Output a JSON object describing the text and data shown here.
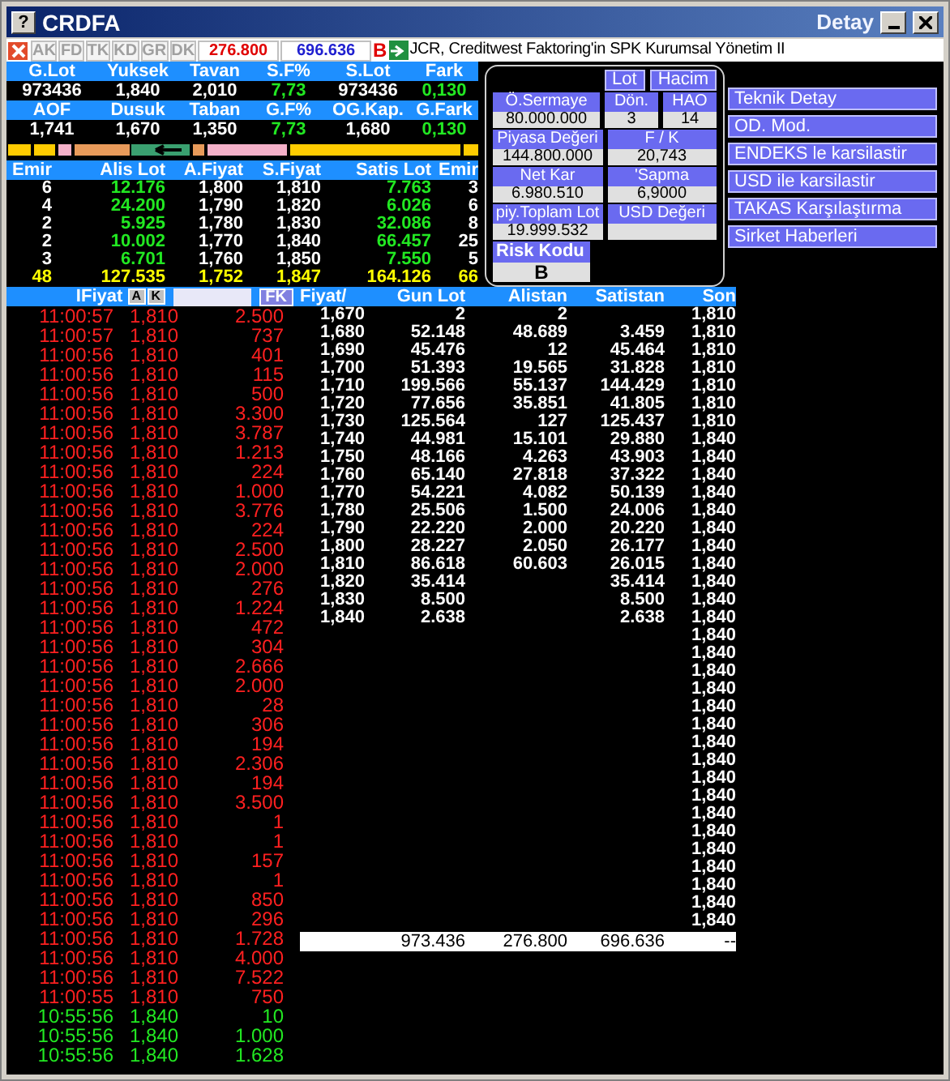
{
  "window": {
    "help": "?",
    "title": "CRDFA",
    "detail_label": "Detay"
  },
  "toolbar": {
    "tabs": [
      "AK",
      "FD",
      "TK",
      "KD",
      "GR",
      "DK"
    ],
    "sell_total": "276.800",
    "buy_total": "696.636",
    "flag": "B",
    "ticker": "JCR, Creditwest Faktoring'in SPK Kurumsal Yönetim II"
  },
  "stats": [
    [
      {
        "label": "G.Lot",
        "value": "973436",
        "kind": "plain"
      },
      {
        "label": "Yuksek",
        "value": "1,840",
        "kind": "plain"
      },
      {
        "label": "Tavan",
        "value": "2,010",
        "kind": "plain"
      },
      {
        "label": "S.F%",
        "value": "7,73",
        "kind": "up"
      },
      {
        "label": "S.Lot",
        "value": "973436",
        "kind": "plain"
      },
      {
        "label": "Fark",
        "value": "0,130",
        "kind": "up"
      }
    ],
    [
      {
        "label": "AOF",
        "value": "1,741",
        "kind": "plain"
      },
      {
        "label": "Dusuk",
        "value": "1,670",
        "kind": "plain"
      },
      {
        "label": "Taban",
        "value": "1,350",
        "kind": "plain"
      },
      {
        "label": "G.F%",
        "value": "7,73",
        "kind": "up"
      },
      {
        "label": "OG.Kap.",
        "value": "1,680",
        "kind": "plain"
      },
      {
        "label": "G.Fark",
        "value": "0,130",
        "kind": "up"
      }
    ]
  ],
  "order_book": {
    "columns": [
      "Emir",
      "Alis Lot",
      "A.Fiyat",
      "S.Fiyat",
      "Satis Lot",
      "Emir"
    ],
    "rows": [
      [
        "6",
        "12.176",
        "1,800",
        "1,810",
        "7.763",
        "3"
      ],
      [
        "4",
        "24.200",
        "1,790",
        "1,820",
        "6.026",
        "6"
      ],
      [
        "2",
        "5.925",
        "1,780",
        "1,830",
        "32.086",
        "8"
      ],
      [
        "2",
        "10.002",
        "1,770",
        "1,840",
        "66.457",
        "25"
      ],
      [
        "3",
        "6.701",
        "1,760",
        "1,850",
        "7.550",
        "5"
      ]
    ],
    "totals": [
      "48",
      "127.535",
      "1,752",
      "1,847",
      "164.126",
      "66"
    ]
  },
  "detail": {
    "buttons": [
      "Lot",
      "Hacim"
    ],
    "field_rows": [
      [
        {
          "label": "Ö.Sermaye",
          "value": "80.000.000"
        },
        {
          "label": "Dön.",
          "value": "3"
        },
        {
          "label": "HAO",
          "value": "14"
        }
      ],
      [
        {
          "label": "Piyasa Değeri",
          "value": "144.800.000"
        },
        {
          "label": "F / K",
          "value": "20,743"
        }
      ],
      [
        {
          "label": "Net Kar",
          "value": "6.980.510"
        },
        {
          "label": "'Sapma",
          "value": "6,9000"
        }
      ],
      [
        {
          "label": "piy.Toplam Lot",
          "value": "19.999.532"
        },
        {
          "label": "USD Değeri"
        }
      ]
    ],
    "risk": {
      "label": "Risk Kodu",
      "value": "B"
    }
  },
  "menu": [
    "Teknik Detay",
    "OD. Mod.",
    "ENDEKS le karsilastir",
    "USD ile karsilastir",
    "TAKAS Karşılaştırma",
    "Sirket Haberleri"
  ],
  "trades": {
    "header": "IFiyat",
    "buttons": [
      "A",
      "K"
    ],
    "fk": "FK",
    "rows": [
      {
        "time": "11:00:57",
        "price": "1,810",
        "lot": "2.500",
        "kind": "sell"
      },
      {
        "time": "11:00:57",
        "price": "1,810",
        "lot": "737",
        "kind": "sell"
      },
      {
        "time": "11:00:56",
        "price": "1,810",
        "lot": "401",
        "kind": "sell"
      },
      {
        "time": "11:00:56",
        "price": "1,810",
        "lot": "115",
        "kind": "sell"
      },
      {
        "time": "11:00:56",
        "price": "1,810",
        "lot": "500",
        "kind": "sell"
      },
      {
        "time": "11:00:56",
        "price": "1,810",
        "lot": "3.300",
        "kind": "sell"
      },
      {
        "time": "11:00:56",
        "price": "1,810",
        "lot": "3.787",
        "kind": "sell"
      },
      {
        "time": "11:00:56",
        "price": "1,810",
        "lot": "1.213",
        "kind": "sell"
      },
      {
        "time": "11:00:56",
        "price": "1,810",
        "lot": "224",
        "kind": "sell"
      },
      {
        "time": "11:00:56",
        "price": "1,810",
        "lot": "1.000",
        "kind": "sell"
      },
      {
        "time": "11:00:56",
        "price": "1,810",
        "lot": "3.776",
        "kind": "sell"
      },
      {
        "time": "11:00:56",
        "price": "1,810",
        "lot": "224",
        "kind": "sell"
      },
      {
        "time": "11:00:56",
        "price": "1,810",
        "lot": "2.500",
        "kind": "sell"
      },
      {
        "time": "11:00:56",
        "price": "1,810",
        "lot": "2.000",
        "kind": "sell"
      },
      {
        "time": "11:00:56",
        "price": "1,810",
        "lot": "276",
        "kind": "sell"
      },
      {
        "time": "11:00:56",
        "price": "1,810",
        "lot": "1.224",
        "kind": "sell"
      },
      {
        "time": "11:00:56",
        "price": "1,810",
        "lot": "472",
        "kind": "sell"
      },
      {
        "time": "11:00:56",
        "price": "1,810",
        "lot": "304",
        "kind": "sell"
      },
      {
        "time": "11:00:56",
        "price": "1,810",
        "lot": "2.666",
        "kind": "sell"
      },
      {
        "time": "11:00:56",
        "price": "1,810",
        "lot": "2.000",
        "kind": "sell"
      },
      {
        "time": "11:00:56",
        "price": "1,810",
        "lot": "28",
        "kind": "sell"
      },
      {
        "time": "11:00:56",
        "price": "1,810",
        "lot": "306",
        "kind": "sell"
      },
      {
        "time": "11:00:56",
        "price": "1,810",
        "lot": "194",
        "kind": "sell"
      },
      {
        "time": "11:00:56",
        "price": "1,810",
        "lot": "2.306",
        "kind": "sell"
      },
      {
        "time": "11:00:56",
        "price": "1,810",
        "lot": "194",
        "kind": "sell"
      },
      {
        "time": "11:00:56",
        "price": "1,810",
        "lot": "3.500",
        "kind": "sell"
      },
      {
        "time": "11:00:56",
        "price": "1,810",
        "lot": "1",
        "kind": "sell"
      },
      {
        "time": "11:00:56",
        "price": "1,810",
        "lot": "1",
        "kind": "sell"
      },
      {
        "time": "11:00:56",
        "price": "1,810",
        "lot": "157",
        "kind": "sell"
      },
      {
        "time": "11:00:56",
        "price": "1,810",
        "lot": "1",
        "kind": "sell"
      },
      {
        "time": "11:00:56",
        "price": "1,810",
        "lot": "850",
        "kind": "sell"
      },
      {
        "time": "11:00:56",
        "price": "1,810",
        "lot": "296",
        "kind": "sell"
      },
      {
        "time": "11:00:56",
        "price": "1,810",
        "lot": "1.728",
        "kind": "sell"
      },
      {
        "time": "11:00:56",
        "price": "1,810",
        "lot": "4.000",
        "kind": "sell"
      },
      {
        "time": "11:00:56",
        "price": "1,810",
        "lot": "7.522",
        "kind": "sell"
      },
      {
        "time": "11:00:55",
        "price": "1,810",
        "lot": "750",
        "kind": "sell"
      },
      {
        "time": "10:55:56",
        "price": "1,840",
        "lot": "10",
        "kind": "buy"
      },
      {
        "time": "10:55:56",
        "price": "1,840",
        "lot": "1.000",
        "kind": "buy"
      },
      {
        "time": "10:55:56",
        "price": "1,840",
        "lot": "1.628",
        "kind": "buy"
      }
    ]
  },
  "price_table": {
    "columns": [
      "Fiyat/",
      "Gun Lot",
      "Alistan",
      "Satistan",
      "Son"
    ],
    "rows": [
      {
        "fiyat": "1,670",
        "gun_lot": "2",
        "alistan": "2",
        "son": "1,810"
      },
      {
        "fiyat": "1,680",
        "gun_lot": "52.148",
        "alistan": "48.689",
        "satistan": "3.459",
        "son": "1,810"
      },
      {
        "fiyat": "1,690",
        "gun_lot": "45.476",
        "alistan": "12",
        "satistan": "45.464",
        "son": "1,810"
      },
      {
        "fiyat": "1,700",
        "gun_lot": "51.393",
        "alistan": "19.565",
        "satistan": "31.828",
        "son": "1,810"
      },
      {
        "fiyat": "1,710",
        "gun_lot": "199.566",
        "alistan": "55.137",
        "satistan": "144.429",
        "son": "1,810"
      },
      {
        "fiyat": "1,720",
        "gun_lot": "77.656",
        "alistan": "35.851",
        "satistan": "41.805",
        "son": "1,810"
      },
      {
        "fiyat": "1,730",
        "gun_lot": "125.564",
        "alistan": "127",
        "satistan": "125.437",
        "son": "1,810"
      },
      {
        "fiyat": "1,740",
        "gun_lot": "44.981",
        "alistan": "15.101",
        "satistan": "29.880",
        "son": "1,840"
      },
      {
        "fiyat": "1,750",
        "gun_lot": "48.166",
        "alistan": "4.263",
        "satistan": "43.903",
        "son": "1,840"
      },
      {
        "fiyat": "1,760",
        "gun_lot": "65.140",
        "alistan": "27.818",
        "satistan": "37.322",
        "son": "1,840"
      },
      {
        "fiyat": "1,770",
        "gun_lot": "54.221",
        "alistan": "4.082",
        "satistan": "50.139",
        "son": "1,840"
      },
      {
        "fiyat": "1,780",
        "gun_lot": "25.506",
        "alistan": "1.500",
        "satistan": "24.006",
        "son": "1,840"
      },
      {
        "fiyat": "1,790",
        "gun_lot": "22.220",
        "alistan": "2.000",
        "satistan": "20.220",
        "son": "1,840"
      },
      {
        "fiyat": "1,800",
        "gun_lot": "28.227",
        "alistan": "2.050",
        "satistan": "26.177",
        "son": "1,840"
      },
      {
        "fiyat": "1,810",
        "gun_lot": "86.618",
        "alistan": "60.603",
        "satistan": "26.015",
        "son": "1,840"
      },
      {
        "fiyat": "1,820",
        "gun_lot": "35.414",
        "satistan": "35.414",
        "son": "1,840"
      },
      {
        "fiyat": "1,830",
        "gun_lot": "8.500",
        "satistan": "8.500",
        "son": "1,840"
      },
      {
        "fiyat": "1,840",
        "gun_lot": "2.638",
        "satistan": "2.638",
        "son": "1,840"
      },
      {
        "son": "1,840"
      },
      {
        "son": "1,840"
      },
      {
        "son": "1,840"
      },
      {
        "son": "1,840"
      },
      {
        "son": "1,840"
      },
      {
        "son": "1,840"
      },
      {
        "son": "1,840"
      },
      {
        "son": "1,840"
      },
      {
        "son": "1,840"
      },
      {
        "son": "1,840"
      },
      {
        "son": "1,840"
      },
      {
        "son": "1,840"
      },
      {
        "son": "1,840"
      },
      {
        "son": "1,840"
      },
      {
        "son": "1,840"
      },
      {
        "son": "1,840"
      },
      {
        "son": "1,840"
      }
    ],
    "totals": {
      "gun_lot": "973.436",
      "alistan": "276.800",
      "satistan": "696.636",
      "son": "--"
    }
  }
}
